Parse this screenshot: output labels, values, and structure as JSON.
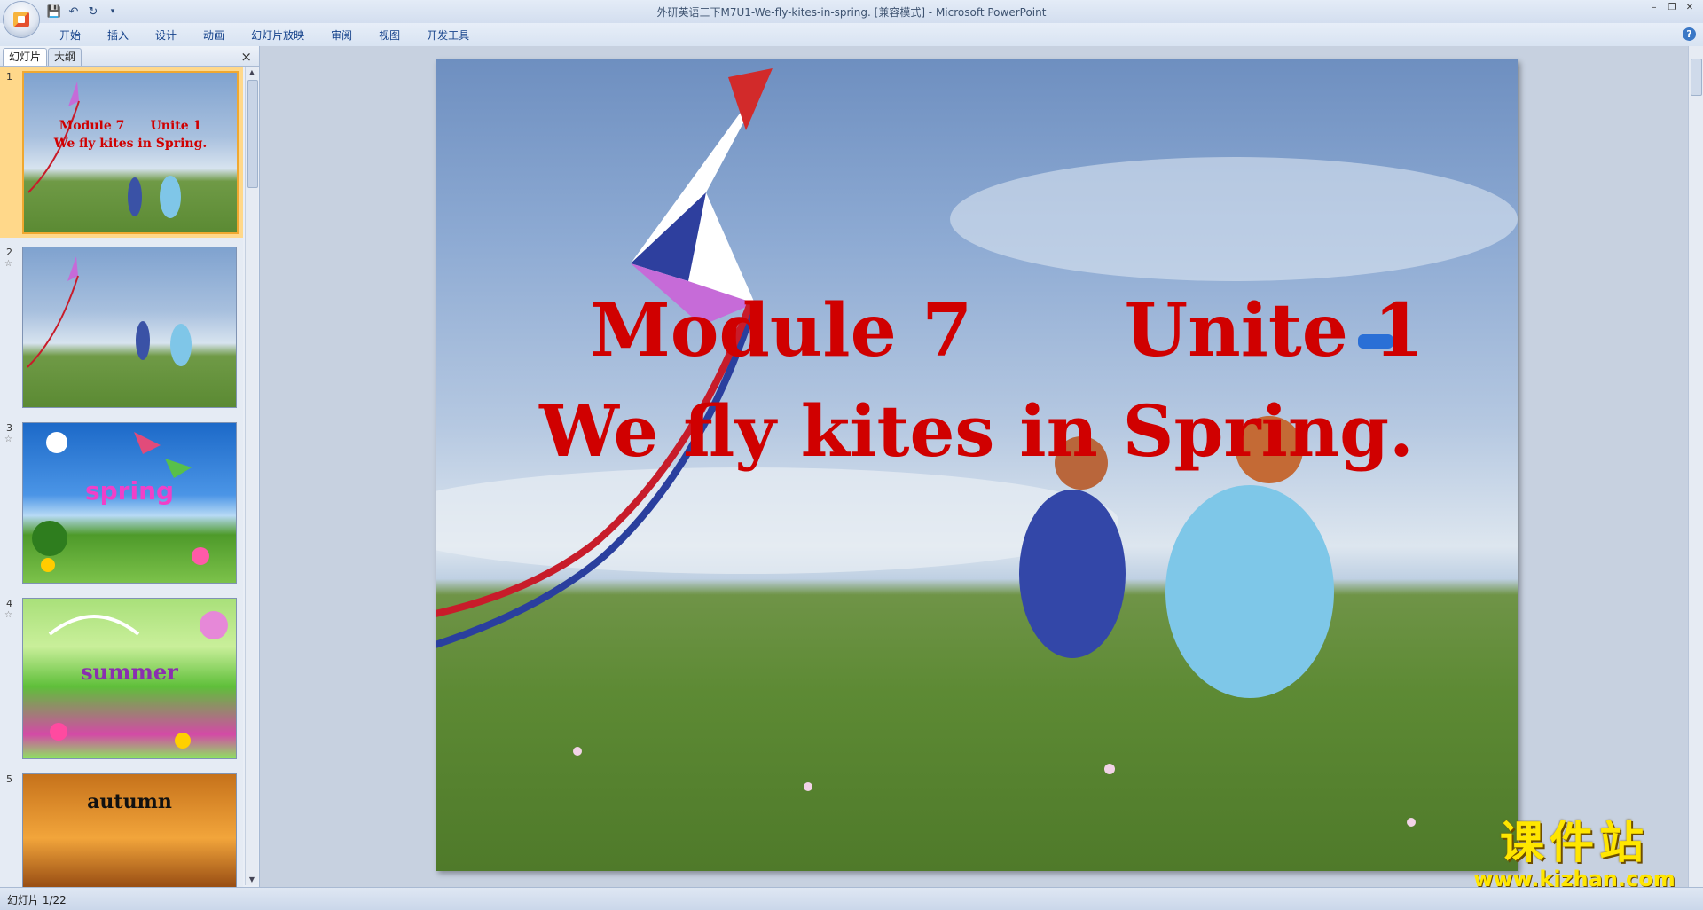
{
  "app": {
    "window_title": "外研英语三下M7U1-We-fly-kites-in-spring. [兼容模式] - Microsoft PowerPoint"
  },
  "quick_access": {
    "save_icon": "save-icon",
    "undo_icon": "undo-icon",
    "redo_icon": "redo-icon",
    "customize_icon": "dropdown-icon"
  },
  "ribbon": {
    "tabs": [
      "开始",
      "插入",
      "设计",
      "动画",
      "幻灯片放映",
      "审阅",
      "视图",
      "开发工具"
    ],
    "help_label": "?"
  },
  "left_pane": {
    "tab_slides": "幻灯片",
    "tab_outline": "大纲",
    "close_label": "×",
    "thumbnails": [
      {
        "number": "1",
        "line1": "Module 7      Unite 1",
        "line2": "We fly kites in Spring.",
        "selected": true
      },
      {
        "number": "2",
        "text": ""
      },
      {
        "number": "3",
        "text": "spring"
      },
      {
        "number": "4",
        "text": "summer"
      },
      {
        "number": "5",
        "text": "autumn"
      }
    ]
  },
  "slide": {
    "title_line1": "Module 7      Unite 1",
    "title_line2": "We fly kites in Spring.",
    "title_color": "#d00000"
  },
  "status": {
    "slide_counter": "幻灯片 1/22"
  },
  "watermark": {
    "big": "课件站",
    "small": "www.kjzhan.com"
  }
}
